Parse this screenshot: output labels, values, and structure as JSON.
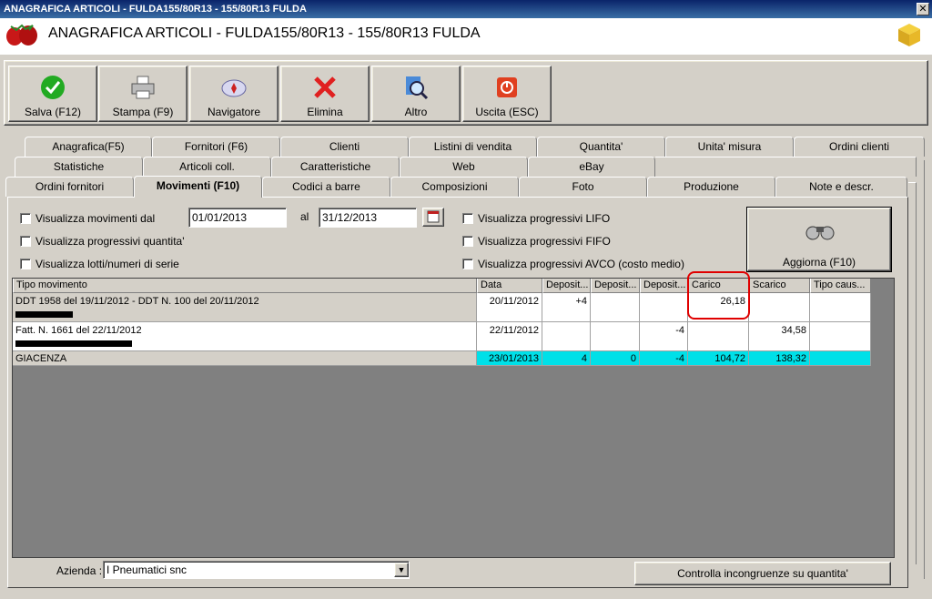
{
  "window": {
    "title": "ANAGRAFICA ARTICOLI - FULDA155/80R13 - 155/80R13 FULDA",
    "close": "✕"
  },
  "header": {
    "title": "ANAGRAFICA ARTICOLI - FULDA155/80R13 - 155/80R13 FULDA"
  },
  "toolbar": {
    "salva": "Salva (F12)",
    "stampa": "Stampa (F9)",
    "navigatore": "Navigatore",
    "elimina": "Elimina",
    "altro": "Altro",
    "uscita": "Uscita (ESC)"
  },
  "tabs": {
    "row1": [
      "Anagrafica(F5)",
      "Fornitori (F6)",
      "Clienti",
      "Listini di vendita",
      "Quantita'",
      "Unita' misura",
      "Ordini clienti"
    ],
    "row2": [
      "Statistiche",
      "Articoli coll.",
      "Caratteristiche",
      "Web",
      "eBay"
    ],
    "row3": [
      "Ordini fornitori",
      "Movimenti (F10)",
      "Codici a barre",
      "Composizioni",
      "Foto",
      "Produzione",
      "Note e descr."
    ]
  },
  "filters": {
    "visualizza_dal": "Visualizza movimenti dal",
    "date_from": "01/01/2013",
    "al": "al",
    "date_to": "31/12/2013",
    "progressivi_quantita": "Visualizza progressivi quantita'",
    "lotti": "Visualizza lotti/numeri di serie",
    "lifo": "Visualizza progressivi LIFO",
    "fifo": "Visualizza progressivi FIFO",
    "avco": "Visualizza progressivi AVCO (costo medio)",
    "aggiorna": "Aggiorna (F10)"
  },
  "table": {
    "headers": [
      "Tipo movimento",
      "Data",
      "Deposit...",
      "Deposit...",
      "Deposit...",
      "Carico",
      "Scarico",
      "Tipo caus..."
    ],
    "rows": [
      {
        "tipo": "DDT 1958 del 19/11/2012 - DDT N. 100 del 20/11/2012",
        "data": "20/11/2012",
        "d1": "+4",
        "d2": "",
        "d3": "",
        "carico": "26,18",
        "scarico": "",
        "causale": ""
      },
      {
        "tipo": "Fatt. N. 1661 del 22/11/2012",
        "data": "22/11/2012",
        "d1": "",
        "d2": "",
        "d3": "-4",
        "carico": "",
        "scarico": "34,58",
        "causale": ""
      }
    ],
    "total": {
      "tipo": "GIACENZA",
      "data": "23/01/2013",
      "d1": "4",
      "d2": "0",
      "d3": "-4",
      "carico": "104,72",
      "scarico": "138,32",
      "causale": ""
    }
  },
  "footer": {
    "azienda_label": "Azienda :",
    "azienda_value": "I Pneumatici snc",
    "controlla": "Controlla incongruenze su quantita'"
  },
  "colors": {
    "titlebar": "#0a246a",
    "total_row": "#00e0e8",
    "highlight": "#e00000"
  }
}
